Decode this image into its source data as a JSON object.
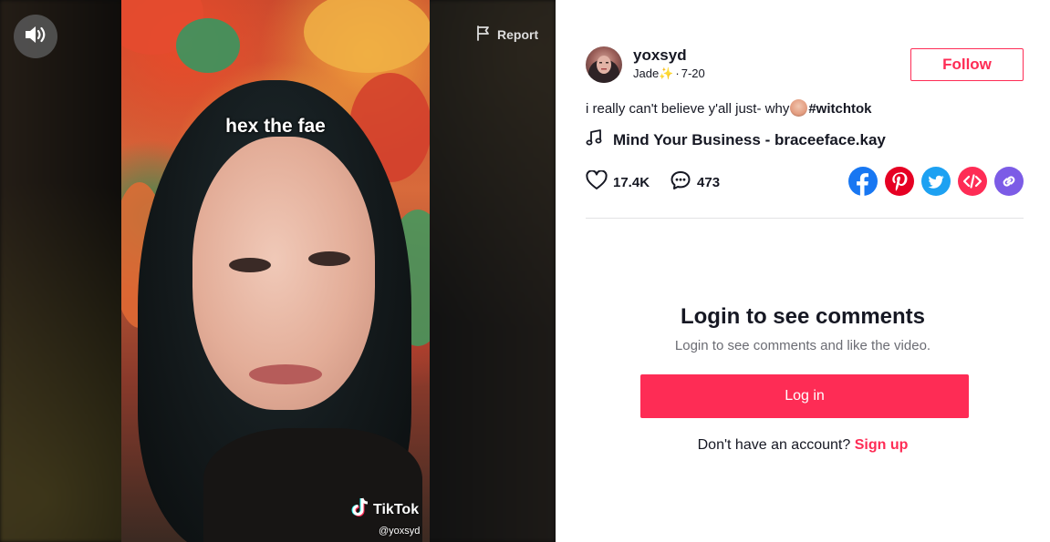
{
  "video": {
    "caption": "hex the fae",
    "report_label": "Report",
    "watermark_brand": "TikTok",
    "watermark_handle": "@yoxsyd",
    "sound_icon": "speaker-on-icon"
  },
  "author": {
    "username": "yoxsyd",
    "nickname": "Jade✨",
    "date": "7-20",
    "separator": "·",
    "follow_label": "Follow"
  },
  "post": {
    "description": "i really can't believe y'all just- why",
    "hashtag": "#witchtok",
    "music_title": "Mind Your Business - braceeface.kay",
    "likes": "17.4K",
    "comments": "473"
  },
  "share": [
    {
      "name": "facebook",
      "icon": "facebook-icon",
      "color": "#1877f2"
    },
    {
      "name": "pinterest",
      "icon": "pinterest-icon",
      "color": "#e60023"
    },
    {
      "name": "twitter",
      "icon": "twitter-icon",
      "color": "#1da1f2"
    },
    {
      "name": "embed",
      "icon": "embed-icon",
      "color": "#fe2c55"
    },
    {
      "name": "copy-link",
      "icon": "link-icon",
      "color": "#7c5ce6"
    }
  ],
  "login": {
    "title": "Login to see comments",
    "subtitle": "Login to see comments and like the video.",
    "button_label": "Log in",
    "signup_prompt": "Don't have an account?",
    "signup_link": "Sign up"
  },
  "colors": {
    "accent": "#fe2c55",
    "text": "#161823",
    "muted": "#6b6c73"
  }
}
